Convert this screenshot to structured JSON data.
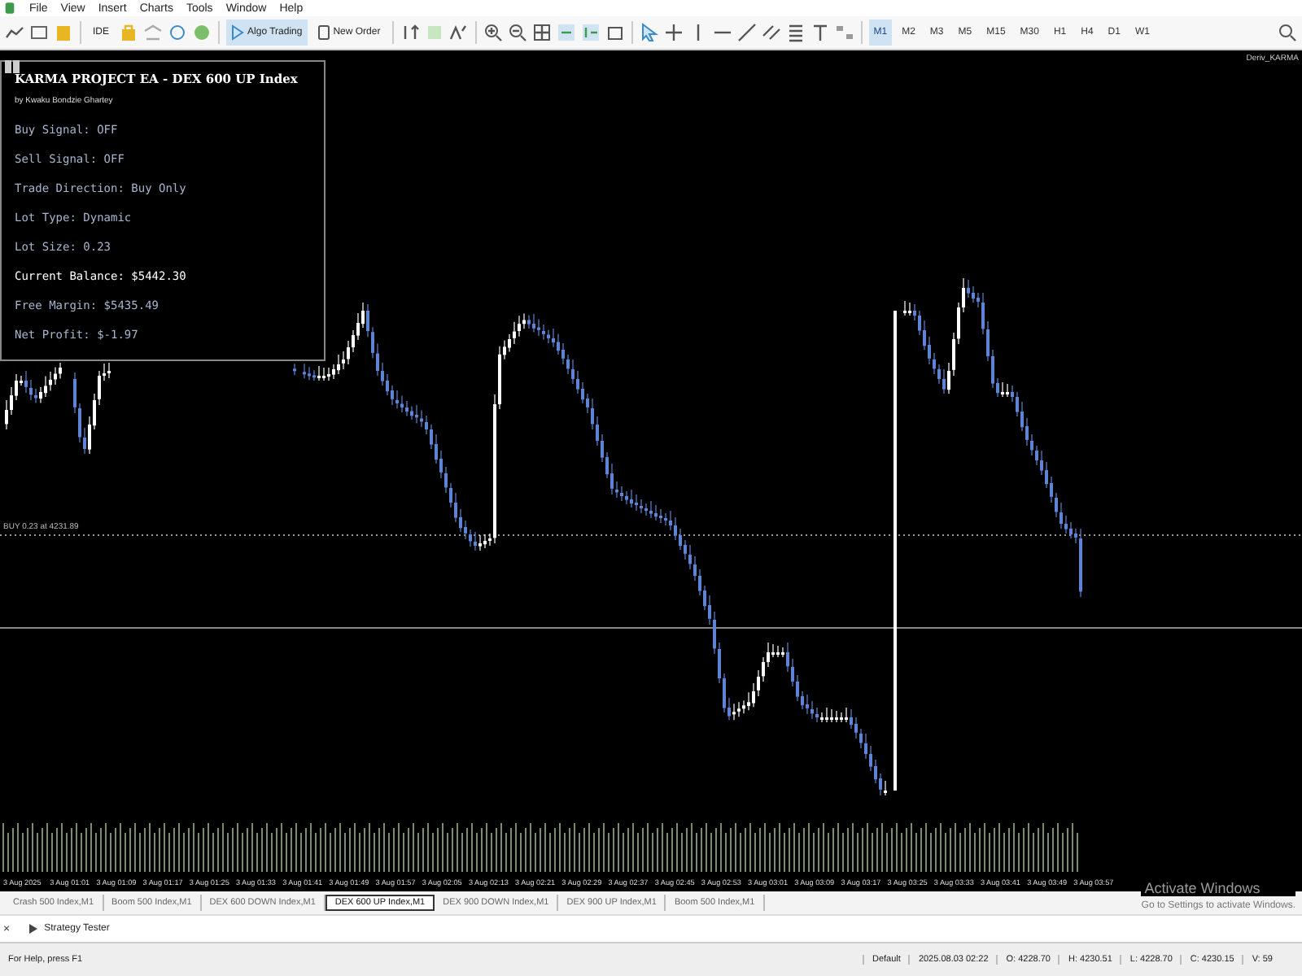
{
  "menu": [
    "File",
    "View",
    "Insert",
    "Charts",
    "Tools",
    "Window",
    "Help"
  ],
  "toolbar": {
    "buttons": [
      {
        "label": "IDE",
        "on": false
      },
      {
        "label": "Algo Trading",
        "on": true
      },
      {
        "label": "New Order",
        "on": false
      }
    ],
    "timeframes": [
      {
        "label": "M1",
        "selected": true
      },
      {
        "label": "M2",
        "selected": false
      },
      {
        "label": "M3",
        "selected": false
      },
      {
        "label": "M5",
        "selected": false
      },
      {
        "label": "M15",
        "selected": false
      },
      {
        "label": "M30",
        "selected": false
      },
      {
        "label": "H1",
        "selected": false
      },
      {
        "label": "H4",
        "selected": false
      },
      {
        "label": "D1",
        "selected": false
      },
      {
        "label": "W1",
        "selected": false
      }
    ]
  },
  "chart": {
    "account": "Deriv_KARMA",
    "trade_line_label": "BUY 0.23 at 4231.89",
    "panel": {
      "title": "KARMA PROJECT EA - DEX 600 UP Index",
      "author": "by Kwaku Bondzie Ghartey",
      "lines": [
        {
          "text": "Buy Signal: OFF",
          "highlighted": false
        },
        {
          "text": "Sell Signal: OFF",
          "highlighted": false
        },
        {
          "text": "Trade Direction: Buy Only",
          "highlighted": false
        },
        {
          "text": "Lot Type: Dynamic",
          "highlighted": false
        },
        {
          "text": "Lot Size: 0.23",
          "highlighted": false
        },
        {
          "text": "Current Balance: $5442.30",
          "highlighted": true
        },
        {
          "text": "Free Margin: $5435.49",
          "highlighted": false
        },
        {
          "text": "Net Profit: $-1.97",
          "highlighted": false
        }
      ]
    },
    "time_axis": [
      "3 Aug 2025",
      "3 Aug 01:01",
      "3 Aug 01:09",
      "3 Aug 01:17",
      "3 Aug 01:25",
      "3 Aug 01:33",
      "3 Aug 01:41",
      "3 Aug 01:49",
      "3 Aug 01:57",
      "3 Aug 02:05",
      "3 Aug 02:13",
      "3 Aug 02:21",
      "3 Aug 02:29",
      "3 Aug 02:37",
      "3 Aug 02:45",
      "3 Aug 02:53",
      "3 Aug 03:01",
      "3 Aug 03:09",
      "3 Aug 03:17",
      "3 Aug 03:25",
      "3 Aug 03:33",
      "3 Aug 03:41",
      "3 Aug 03:49",
      "3 Aug 03:57"
    ]
  },
  "os_notice": {
    "title": "Activate Windows",
    "subtitle": "Go to Settings to activate Windows."
  },
  "chart_tabs": [
    {
      "label": "Crash 500 Index,M1",
      "selected": false
    },
    {
      "label": "Boom 500 Index,M1",
      "selected": false
    },
    {
      "label": "DEX 600 DOWN Index,M1",
      "selected": false
    },
    {
      "label": "DEX 600 UP Index,M1",
      "selected": true
    },
    {
      "label": "DEX 900 DOWN Index,M1",
      "selected": false
    },
    {
      "label": "DEX 900 UP Index,M1",
      "selected": false
    },
    {
      "label": "Boom 500 Index,M1",
      "selected": false
    }
  ],
  "toolbox": {
    "close": "×",
    "tab": "Strategy Tester"
  },
  "status_bar": [
    "For Help, press F1",
    "Default",
    "2025.08.03 02:22",
    "O: 4228.70",
    "H: 4230.51",
    "L: 4228.70",
    "C: 4230.15",
    "V: 59"
  ]
}
